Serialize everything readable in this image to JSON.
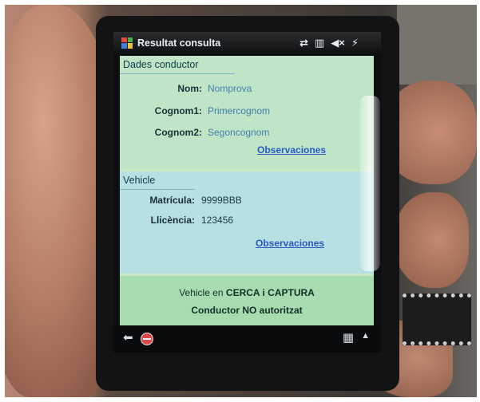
{
  "window": {
    "title": "Resultat consulta",
    "status_icons": [
      "connectivity-icon",
      "signal-icon",
      "mute-icon",
      "power-icon"
    ]
  },
  "driver": {
    "header": "Dades conductor",
    "fields": [
      {
        "label": "Nom:",
        "value": "Nomprova"
      },
      {
        "label": "Cognom1:",
        "value": "Primercognom"
      },
      {
        "label": "Cognom2:",
        "value": "Segoncognom"
      }
    ],
    "link": "Observaciones"
  },
  "vehicle": {
    "header": "Vehicle",
    "fields": [
      {
        "label": "Matrícula:",
        "value": "9999BBB"
      },
      {
        "label": "Llicència:",
        "value": "123456"
      }
    ],
    "link": "Observaciones"
  },
  "notice": {
    "line1_prefix": "Vehicle en",
    "line1_status": "CERCA i CAPTURA",
    "line2": "Conductor NO autoritzat"
  },
  "bottombar": {
    "left_icons": [
      "back-icon",
      "stop-icon"
    ],
    "right_icons": [
      "keyboard-icon",
      "up-arrow-icon"
    ]
  },
  "colors": {
    "driver_section": "#bfe5c6",
    "vehicle_section": "#b7e0e2",
    "notice": "#a6dcb0",
    "link": "#2a59c4",
    "value_text": "#3f7fb0"
  }
}
